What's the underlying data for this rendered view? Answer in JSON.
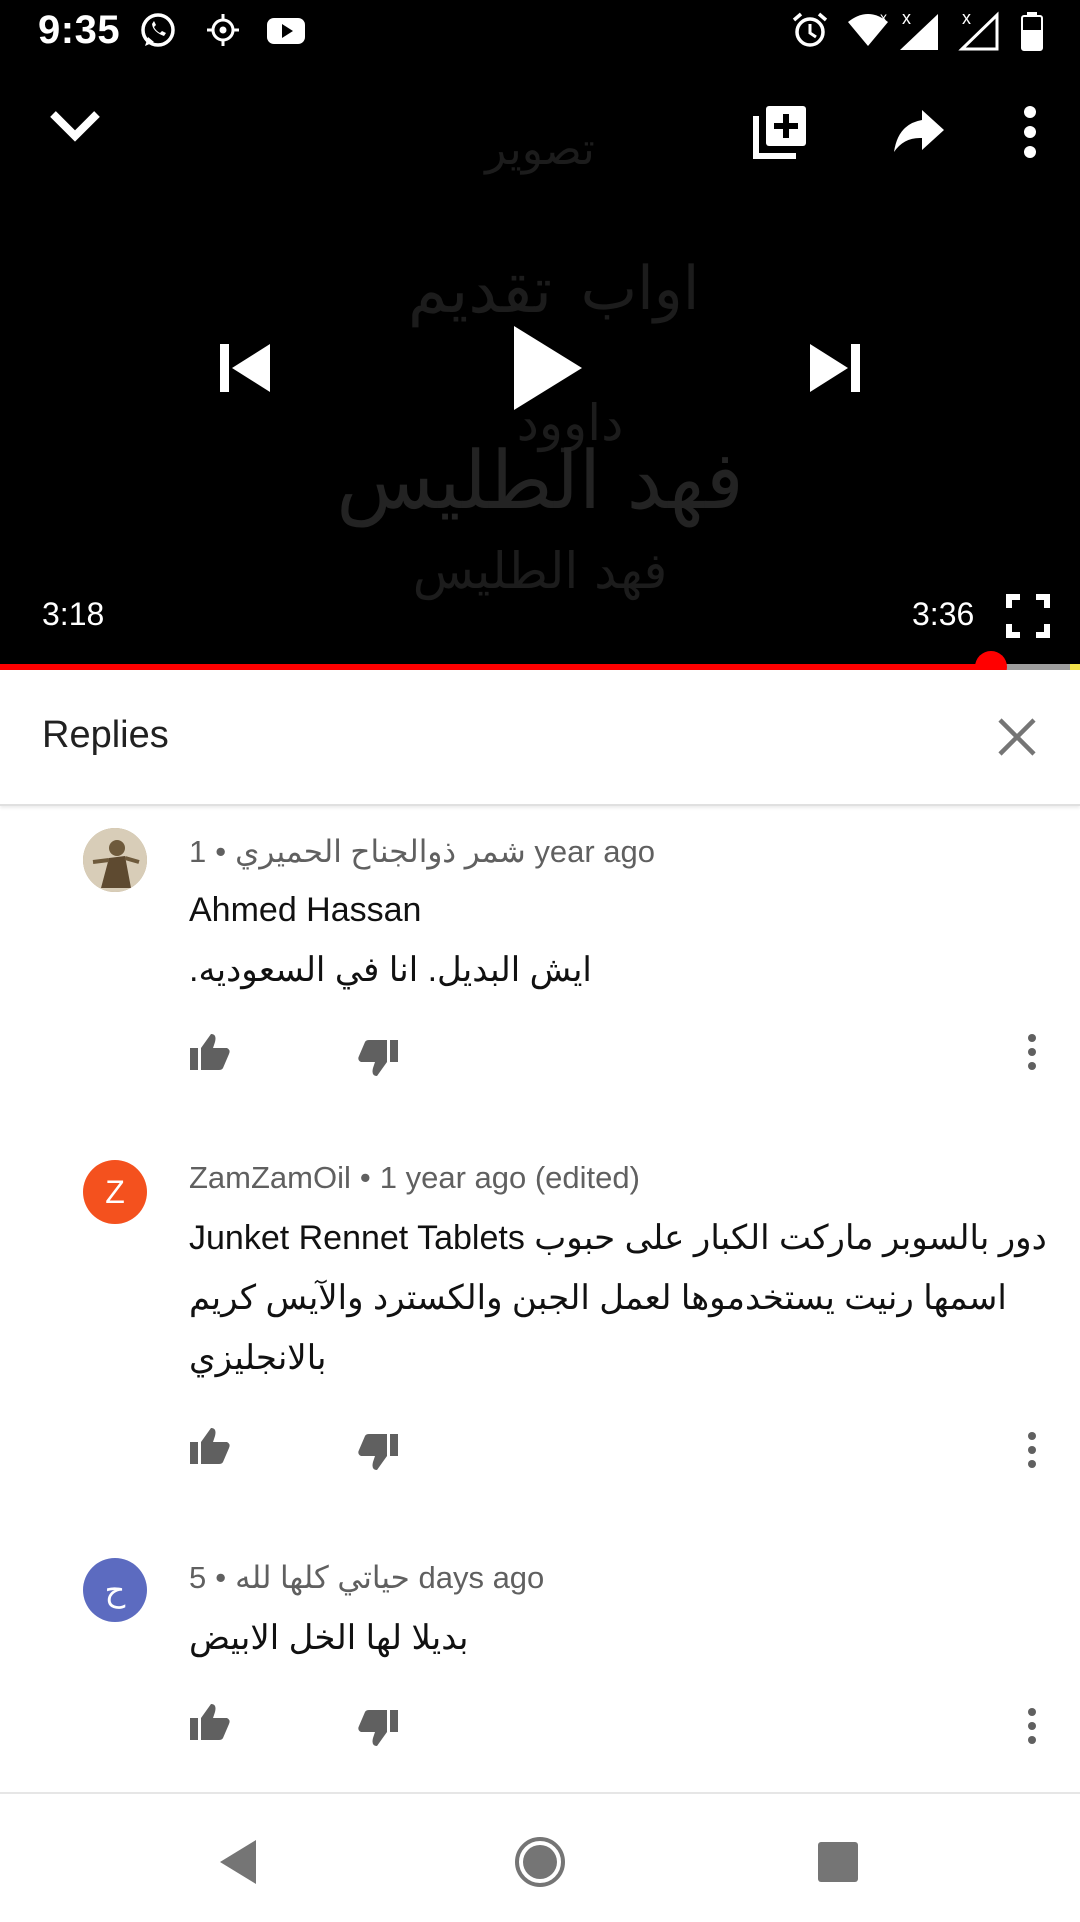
{
  "status_bar": {
    "time": "9:35",
    "icons": [
      "whatsapp-icon",
      "location-icon",
      "youtube-icon",
      "alarm-icon",
      "wifi-icon",
      "signal-icon",
      "signal-icon",
      "battery-icon"
    ]
  },
  "player": {
    "elapsed": "3:18",
    "duration": "3:36",
    "progress": 0.918,
    "background_text": [
      "تصوير",
      "اواب",
      "تقديم",
      "داوود",
      "فهد الطليس",
      "فهد الطليس"
    ]
  },
  "replies": {
    "title": "Replies"
  },
  "comments": [
    {
      "author": "شمر ذوالجناح الحميري",
      "time": "1 year ago",
      "mention": "Ahmed Hassan",
      "text": "ايش البديل.  انا في السعوديه.",
      "avatar_letter": "",
      "avatar_color": "#8d7b55"
    },
    {
      "author": "ZamZamOil",
      "time": "1 year ago (edited)",
      "text_lines": [
        "دور بالسوبر ماركت الكبار على حبوب",
        "Junket Rennet Tablets",
        "اسمها رنيت يستخدموها لعمل الجبن والكسترد والآيس كريم",
        "بالانجليزي"
      ],
      "avatar_letter": "Z",
      "avatar_color": "#f4511e"
    },
    {
      "author": "حياتي كلها لله",
      "time": "5 days ago",
      "text": "بديلا لها الخل الابيض",
      "avatar_letter": "ح",
      "avatar_color": "#5c6bc0"
    }
  ],
  "colors": {
    "progress": "#ff0000",
    "meta_text": "#606060",
    "icon_gray": "#606060"
  }
}
